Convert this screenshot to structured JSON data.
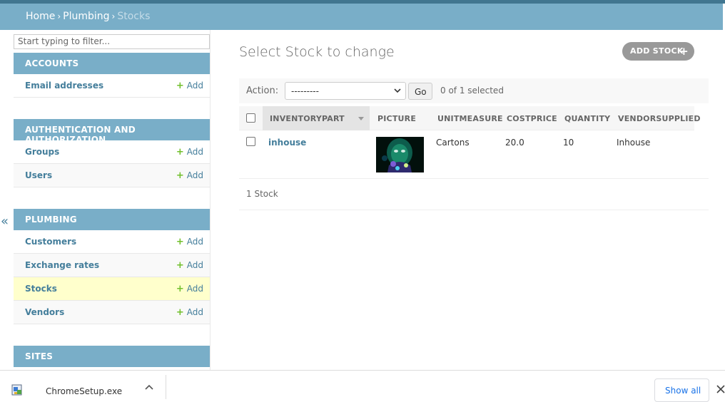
{
  "breadcrumbs": {
    "home": "Home",
    "app": "Plumbing",
    "current": "Stocks",
    "separator": "›"
  },
  "sidebar": {
    "filter_placeholder": "Start typing to filter...",
    "collapse_glyph": "«",
    "add_label": "Add",
    "add_glyph": "+",
    "modules": [
      {
        "caption": "ACCOUNTS",
        "models": [
          "Email addresses"
        ]
      },
      {
        "caption": "AUTHENTICATION AND AUTHORIZATION",
        "models": [
          "Groups",
          "Users"
        ]
      },
      {
        "caption": "PLUMBING",
        "models": [
          "Customers",
          "Exchange rates",
          "Stocks",
          "Vendors"
        ]
      },
      {
        "caption": "SITES",
        "models": []
      }
    ]
  },
  "main": {
    "title": "Select Stock to change",
    "add_button": "ADD STOCK",
    "action_label": "Action:",
    "action_selected": "---------",
    "go_label": "Go",
    "selected_text": "0 of 1 selected",
    "columns": [
      "INVENTORYPART",
      "PICTURE",
      "UNITMEASURE",
      "COSTPRICE",
      "QUANTITY",
      "VENDORSUPPLIED"
    ],
    "rows": [
      {
        "inventorypart": "inhouse",
        "unitmeasure": "Cartons",
        "costprice": "20.0",
        "quantity": "10",
        "vendorsupplied": "Inhouse"
      }
    ],
    "paginator": "1 Stock"
  },
  "download_bar": {
    "file_name": "ChromeSetup.exe",
    "show_all": "Show all"
  },
  "colors": {
    "header_bar": "#417690",
    "breadcrumb_bg": "#79aec8",
    "link": "#447e9b",
    "add_green": "#70bf2b",
    "current_row": "#ffffcc"
  }
}
